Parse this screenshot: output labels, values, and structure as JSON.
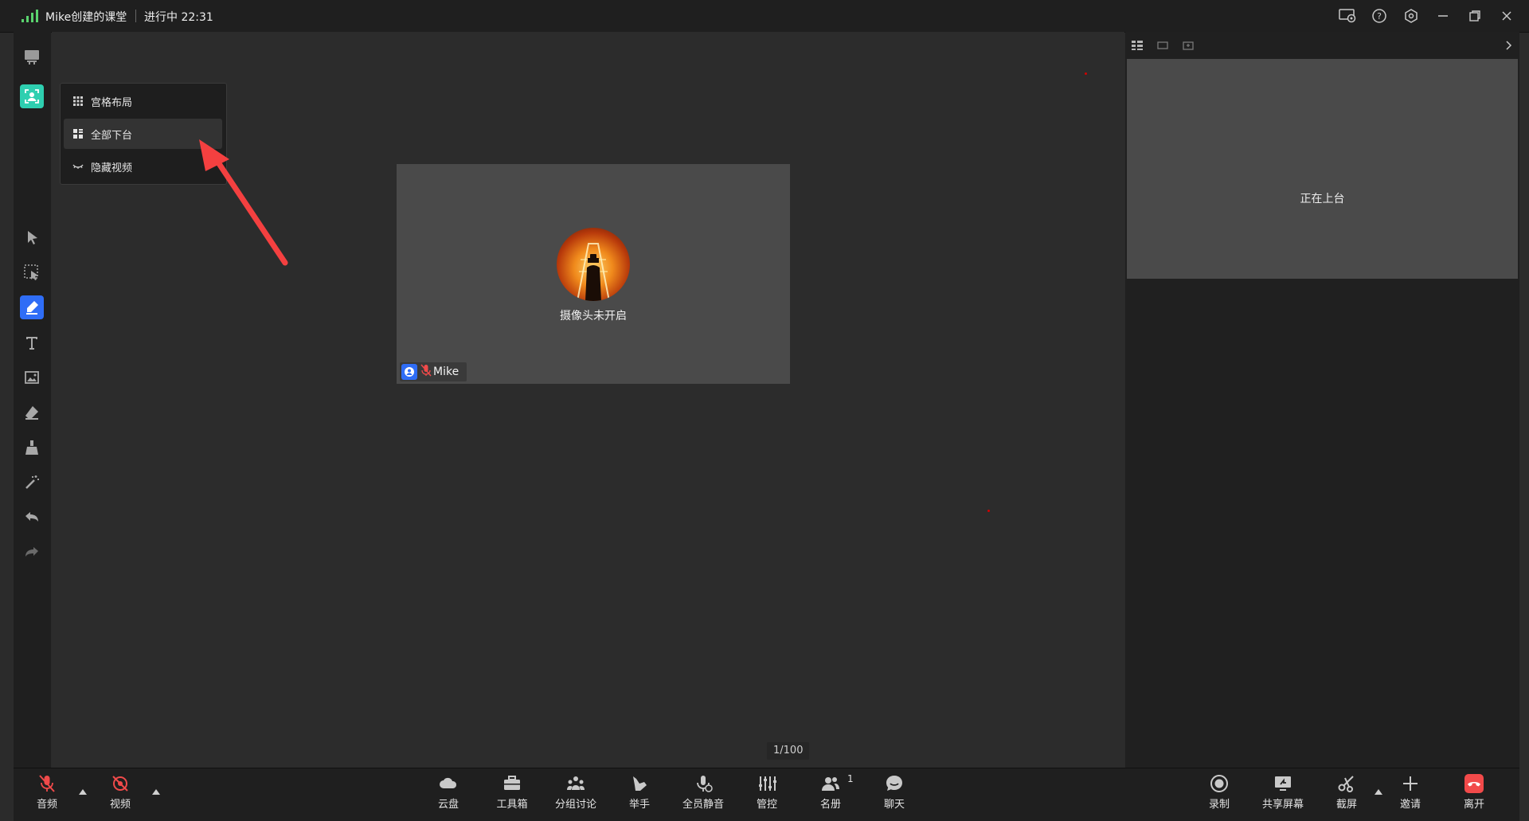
{
  "window": {
    "title": "Mike创建的课堂",
    "status": "进行中 22:31"
  },
  "layout_menu": {
    "items": [
      {
        "label": "宫格布局"
      },
      {
        "label": "全部下台"
      },
      {
        "label": "隐藏视频"
      }
    ],
    "selected_index": 1
  },
  "video_tile": {
    "camera_status": "摄像头未开启",
    "participant_name": "Mike"
  },
  "page_indicator": "1/100",
  "right_panel": {
    "onstage_text": "正在上台"
  },
  "bottom_bar": {
    "audio": "音频",
    "video": "视频",
    "cloud": "云盘",
    "toolbox": "工具箱",
    "group": "分组讨论",
    "raise_hand": "举手",
    "mute_all": "全员静音",
    "control": "管控",
    "roster": "名册",
    "roster_count": "1",
    "chat": "聊天",
    "record": "录制",
    "share_screen": "共享屏幕",
    "screenshot": "截屏",
    "invite": "邀请",
    "leave": "离开"
  },
  "colors": {
    "accent": "#2f6df6",
    "signal": "#5ad36e",
    "leave": "#f24a4a",
    "arrow": "#f44040",
    "teal": "#2ecfb0"
  },
  "icons": {
    "window_controls": [
      "screen-record-icon",
      "help-icon",
      "settings-icon",
      "minimize-icon",
      "restore-icon",
      "close-icon"
    ]
  }
}
